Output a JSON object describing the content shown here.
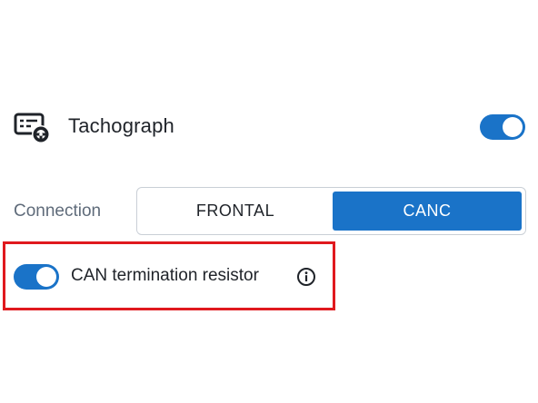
{
  "tachograph": {
    "icon": "tachograph-icon",
    "label": "Tachograph",
    "enabled": true
  },
  "connection": {
    "label": "Connection",
    "options": [
      "FRONTAL",
      "CANC"
    ],
    "selected": "CANC"
  },
  "can_termination": {
    "label": "CAN termination resistor",
    "enabled": true,
    "info_icon": "info-icon"
  },
  "colors": {
    "accent": "#1a73c8",
    "highlight": "#e0191e",
    "muted_text": "#5f6b7a"
  }
}
